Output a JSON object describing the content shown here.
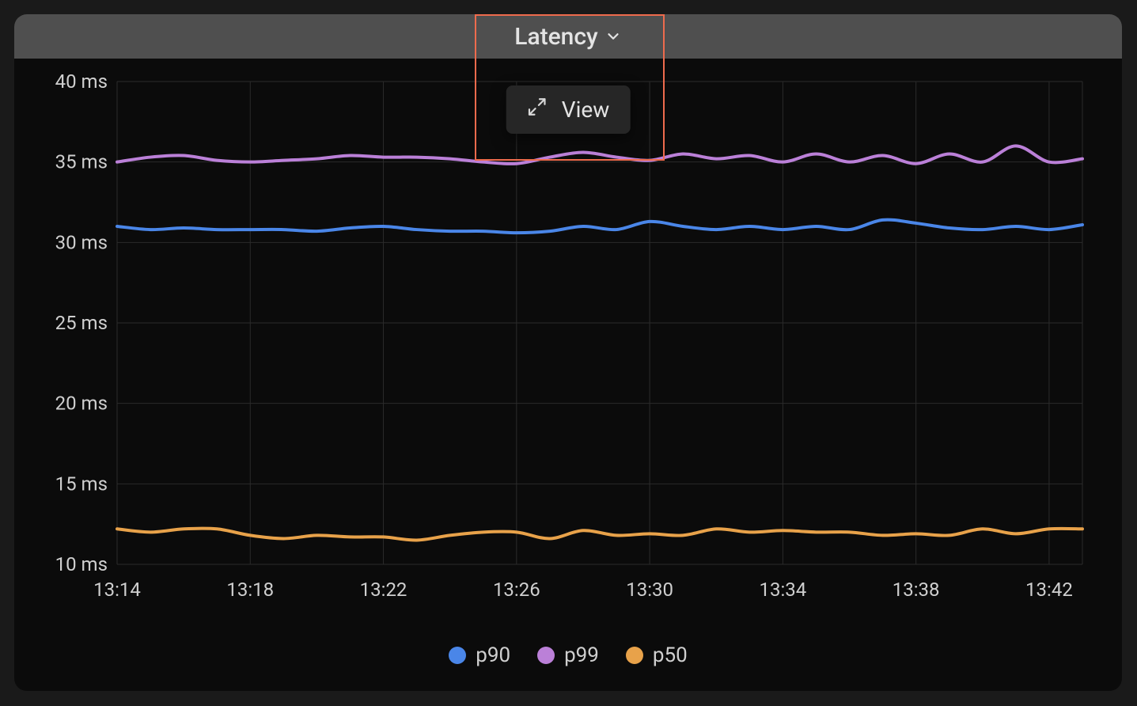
{
  "panel": {
    "title": "Latency",
    "menu": {
      "view_label": "View"
    }
  },
  "legend": [
    {
      "name": "p90",
      "color": "#4a86e8"
    },
    {
      "name": "p99",
      "color": "#bb80d8"
    },
    {
      "name": "p50",
      "color": "#e8a24a"
    }
  ],
  "chart_data": {
    "type": "line",
    "title": "Latency",
    "xlabel": "",
    "ylabel": "",
    "ylim": [
      10,
      40
    ],
    "y_ticks": [
      "10 ms",
      "15 ms",
      "20 ms",
      "25 ms",
      "30 ms",
      "35 ms",
      "40 ms"
    ],
    "y_tick_values": [
      10,
      15,
      20,
      25,
      30,
      35,
      40
    ],
    "x_ticks": [
      "13:14",
      "13:18",
      "13:22",
      "13:26",
      "13:30",
      "13:34",
      "13:38",
      "13:42"
    ],
    "x": [
      "13:14",
      "13:15",
      "13:16",
      "13:17",
      "13:18",
      "13:19",
      "13:20",
      "13:21",
      "13:22",
      "13:23",
      "13:24",
      "13:25",
      "13:26",
      "13:27",
      "13:28",
      "13:29",
      "13:30",
      "13:31",
      "13:32",
      "13:33",
      "13:34",
      "13:35",
      "13:36",
      "13:37",
      "13:38",
      "13:39",
      "13:40",
      "13:41",
      "13:42",
      "13:43"
    ],
    "series": [
      {
        "name": "p99",
        "color": "#bb80d8",
        "values": [
          35.0,
          35.3,
          35.4,
          35.1,
          35.0,
          35.1,
          35.2,
          35.4,
          35.3,
          35.3,
          35.2,
          35.0,
          34.9,
          35.3,
          35.6,
          35.3,
          35.1,
          35.5,
          35.2,
          35.4,
          35.0,
          35.5,
          35.0,
          35.4,
          34.9,
          35.5,
          35.0,
          36.0,
          35.0,
          35.2
        ]
      },
      {
        "name": "p90",
        "color": "#4a86e8",
        "values": [
          31.0,
          30.8,
          30.9,
          30.8,
          30.8,
          30.8,
          30.7,
          30.9,
          31.0,
          30.8,
          30.7,
          30.7,
          30.6,
          30.7,
          31.0,
          30.8,
          31.3,
          31.0,
          30.8,
          31.0,
          30.8,
          31.0,
          30.8,
          31.4,
          31.2,
          30.9,
          30.8,
          31.0,
          30.8,
          31.1
        ]
      },
      {
        "name": "p50",
        "color": "#e8a24a",
        "values": [
          12.2,
          12.0,
          12.2,
          12.2,
          11.8,
          11.6,
          11.8,
          11.7,
          11.7,
          11.5,
          11.8,
          12.0,
          12.0,
          11.6,
          12.1,
          11.8,
          11.9,
          11.8,
          12.2,
          12.0,
          12.1,
          12.0,
          12.0,
          11.8,
          11.9,
          11.8,
          12.2,
          11.9,
          12.2,
          12.2
        ]
      }
    ]
  }
}
